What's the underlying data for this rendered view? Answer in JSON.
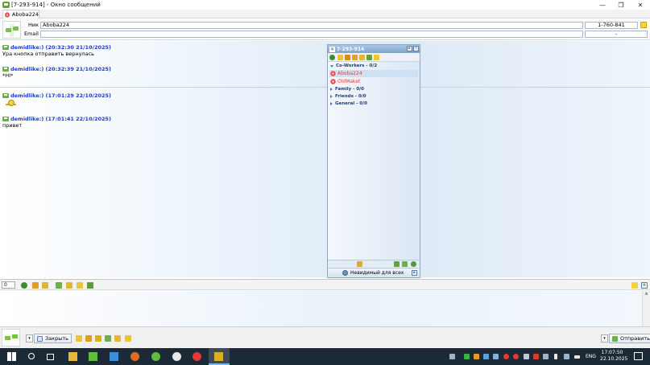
{
  "window": {
    "title": "[7-293-914] - Окно сообщений",
    "controls": {
      "minimize": "—",
      "maximize": "❐",
      "close": "✕"
    }
  },
  "tabs": [
    {
      "label": "Aboba224",
      "icon": "flower-icon"
    }
  ],
  "contact_info": {
    "nick_label": "Ник",
    "nick_value": "Aboba224",
    "email_label": "Email",
    "email_value": "",
    "uin": "1-760-841",
    "extra": "-"
  },
  "messages": [
    {
      "header": "demidlike:) (20:32:30 21/10/2025)",
      "text": "Ура кнопка отправить вернулась"
    },
    {
      "header": "demidlike:) (20:32:39 21/10/2025)",
      "text": "*HI*"
    },
    {
      "header": "demidlike:) (17:01:29 22/10/2025)",
      "text": "",
      "smiley": true
    },
    {
      "header": "demidlike:) (17:01:41 22/10/2025)",
      "text": "привет"
    }
  ],
  "contact_list": {
    "title": "7-293-914",
    "groups": [
      {
        "label": "Co-Workers - 0/2",
        "expanded": true
      },
      {
        "label": "Family - 0/0",
        "expanded": false
      },
      {
        "label": "Friends - 0/0",
        "expanded": false
      },
      {
        "label": "General - 0/0",
        "expanded": false
      }
    ],
    "contacts": [
      {
        "name": "Aboba224",
        "selected": true
      },
      {
        "name": "OldMaket",
        "selected": false
      }
    ],
    "status": "Невидимый для всех"
  },
  "input_bar": {
    "char_count": "0"
  },
  "actions": {
    "close_label": "Закрыть",
    "send_label": "Отправить"
  },
  "taskbar": {
    "lang": "ENG",
    "time": "17:07:50",
    "date": "22.10.2025"
  },
  "colors": {
    "accent_blue": "#1c3bcf",
    "contact_offline": "#e23b3b",
    "taskbar": "#1c2a38"
  }
}
